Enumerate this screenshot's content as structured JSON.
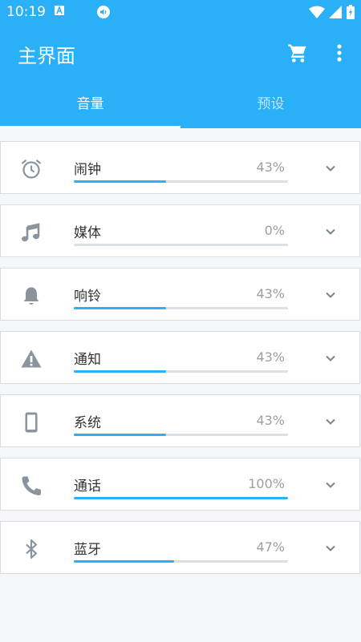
{
  "status_bar": {
    "time": "10:19",
    "icons": [
      "a-icon",
      "volume-icon",
      "wifi-icon",
      "signal-icon",
      "battery-icon"
    ]
  },
  "app": {
    "title": "主界面",
    "accent": "#29b0f7"
  },
  "toolbar": {
    "actions": [
      "cart-icon",
      "more-vert-icon"
    ]
  },
  "tabs": [
    {
      "label": "音量",
      "active": true
    },
    {
      "label": "预设",
      "active": false
    }
  ],
  "channels": [
    {
      "id": "alarm",
      "label": "闹钟",
      "percent_text": "43%",
      "level": 0.43,
      "icon": "alarm-clock-icon"
    },
    {
      "id": "media",
      "label": "媒体",
      "percent_text": "0%",
      "level": 0.0,
      "icon": "music-note-icon"
    },
    {
      "id": "ringer",
      "label": "响铃",
      "percent_text": "43%",
      "level": 0.43,
      "icon": "bell-icon"
    },
    {
      "id": "notification",
      "label": "通知",
      "percent_text": "43%",
      "level": 0.43,
      "icon": "warning-icon"
    },
    {
      "id": "system",
      "label": "系统",
      "percent_text": "43%",
      "level": 0.43,
      "icon": "phone-device-icon"
    },
    {
      "id": "call",
      "label": "通话",
      "percent_text": "100%",
      "level": 1.0,
      "icon": "phone-call-icon"
    },
    {
      "id": "bluetooth",
      "label": "蓝牙",
      "percent_text": "47%",
      "level": 0.47,
      "icon": "bluetooth-icon"
    }
  ]
}
